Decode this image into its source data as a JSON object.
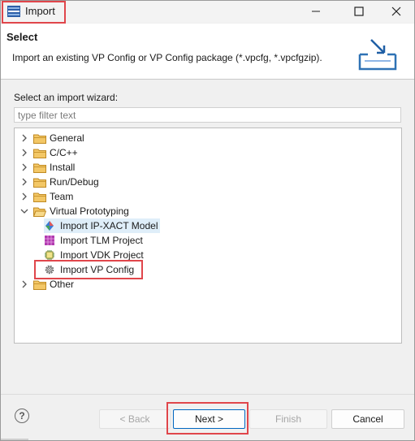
{
  "window": {
    "title": "Import"
  },
  "header": {
    "title": "Select",
    "description": "Import an existing VP Config or VP Config package (*.vpcfg, *.vpcfgzip)."
  },
  "wizard": {
    "label": "Select an import wizard:",
    "filter_placeholder": "type filter text",
    "filter_value": ""
  },
  "tree": {
    "items": [
      {
        "label": "General",
        "icon": "folder-icon",
        "expanded": false
      },
      {
        "label": "C/C++",
        "icon": "folder-icon",
        "expanded": false
      },
      {
        "label": "Install",
        "icon": "folder-icon",
        "expanded": false
      },
      {
        "label": "Run/Debug",
        "icon": "folder-icon",
        "expanded": false
      },
      {
        "label": "Team",
        "icon": "folder-icon",
        "expanded": false
      },
      {
        "label": "Virtual Prototyping",
        "icon": "folder-icon",
        "expanded": true,
        "children": [
          {
            "label": "Import IP-XACT Model",
            "icon": "ip-xact-icon"
          },
          {
            "label": "Import TLM Project",
            "icon": "tlm-project-icon"
          },
          {
            "label": "Import VDK Project",
            "icon": "vdk-chip-icon"
          },
          {
            "label": "Import VP Config",
            "icon": "gear-icon"
          }
        ]
      },
      {
        "label": "Other",
        "icon": "folder-icon",
        "expanded": false
      }
    ]
  },
  "buttons": {
    "help": "?",
    "back": "< Back",
    "next": "Next >",
    "finish": "Finish",
    "cancel": "Cancel"
  },
  "colors": {
    "annotation_red": "#e0464b",
    "selection_blue": "#dfeef9",
    "default_button_border": "#0067c0",
    "folder_yellow": "#e8b94a"
  }
}
